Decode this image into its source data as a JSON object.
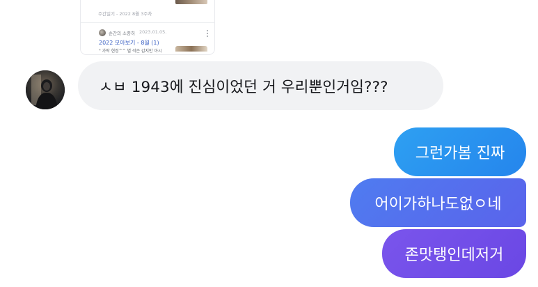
{
  "shared_card": {
    "caption": "주간일기 - 2022 8월 3주차",
    "post": {
      "author": "순간의 소중히",
      "date": "2023.01.05.",
      "title": "2022 모아보기 - 8월 (1)",
      "snippet": "\" 가락 현정^^ 별 석은 감지만 아시"
    }
  },
  "messages": {
    "incoming": {
      "text": "ㅅㅂ 1943에 진심이었던 거 우리뿐인거임???"
    },
    "outgoing": [
      {
        "text": "그런가봄 진짜"
      },
      {
        "text": "어이가하나도없ㅇ네"
      },
      {
        "text": "존맛탱인데저거"
      }
    ]
  },
  "colors": {
    "incoming_bubble": "#f1f2f4",
    "outgoing_1": "#2a92ef",
    "outgoing_2": "#5470ee",
    "outgoing_3": "#7250e9",
    "link_title": "#3c62c4"
  },
  "icons": {
    "post_more": "more-vertical-icon"
  }
}
